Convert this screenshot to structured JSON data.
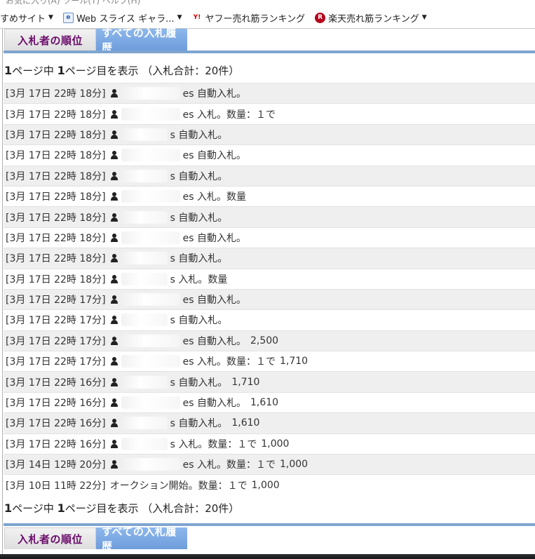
{
  "browser": {
    "menu_strip": "お気に入り(A)   ツール(T)   ヘルプ(H)",
    "favorites": [
      {
        "label": "すめサイト",
        "icon": "none",
        "dropdown": true
      },
      {
        "label": "Web スライス ギャラ...",
        "icon": "web-slice-icon",
        "dropdown": true
      },
      {
        "label": "ヤフー売れ筋ランキング",
        "icon": "yahoo-icon",
        "dropdown": false
      },
      {
        "label": "楽天売れ筋ランキング",
        "icon": "rakuten-icon",
        "dropdown": true
      }
    ]
  },
  "tabs": {
    "rank_label": "入札者の順位",
    "history_label": "すべての入札履歴"
  },
  "pagination": {
    "page_total": "1",
    "text_mid": "ページ中 ",
    "page_current": "1",
    "text_end": "ページ目を表示 （入札合計：20件）"
  },
  "bids": [
    {
      "time": "[3月 17日 22時 18分]",
      "user": true,
      "mask": "m1",
      "msg": "es 自動入札。",
      "amount": ""
    },
    {
      "time": "[3月 17日 22時 18分]",
      "user": true,
      "mask": "m1",
      "msg": "es 入札。数量：１で",
      "amount": ""
    },
    {
      "time": "[3月 17日 22時 18分]",
      "user": true,
      "mask": "m2",
      "msg": "s 自動入札。",
      "amount": ""
    },
    {
      "time": "[3月 17日 22時 18分]",
      "user": true,
      "mask": "m1",
      "msg": "es 自動入札。",
      "amount": ""
    },
    {
      "time": "[3月 17日 22時 18分]",
      "user": true,
      "mask": "m2",
      "msg": "s 自動入札。",
      "amount": ""
    },
    {
      "time": "[3月 17日 22時 18分]",
      "user": true,
      "mask": "m1",
      "msg": "es 入札。数量",
      "amount": ""
    },
    {
      "time": "[3月 17日 22時 18分]",
      "user": true,
      "mask": "m2",
      "msg": "s 自動入札。",
      "amount": ""
    },
    {
      "time": "[3月 17日 22時 18分]",
      "user": true,
      "mask": "m1",
      "msg": "es 自動入札。",
      "amount": ""
    },
    {
      "time": "[3月 17日 22時 18分]",
      "user": true,
      "mask": "m2",
      "msg": "s 自動入札。",
      "amount": ""
    },
    {
      "time": "[3月 17日 22時 18分]",
      "user": true,
      "mask": "m2",
      "msg": "s 入札。数量",
      "amount": ""
    },
    {
      "time": "[3月 17日 22時 17分]",
      "user": true,
      "mask": "m1",
      "msg": "es 自動入札。",
      "amount": ""
    },
    {
      "time": "[3月 17日 22時 17分]",
      "user": true,
      "mask": "m2",
      "msg": "s 自動入札。",
      "amount": ""
    },
    {
      "time": "[3月 17日 22時 17分]",
      "user": true,
      "mask": "m1",
      "msg": "es 自動入札。",
      "amount": "2,500"
    },
    {
      "time": "[3月 17日 22時 17分]",
      "user": true,
      "mask": "m1",
      "msg": "es 入札。数量：１で",
      "amount": "1,710"
    },
    {
      "time": "[3月 17日 22時 16分]",
      "user": true,
      "mask": "m2",
      "msg": "s 自動入札。",
      "amount": "1,710"
    },
    {
      "time": "[3月 17日 22時 16分]",
      "user": true,
      "mask": "m1",
      "msg": "es 自動入札。",
      "amount": "1,610"
    },
    {
      "time": "[3月 17日 22時 16分]",
      "user": true,
      "mask": "m2",
      "msg": "s 自動入札。",
      "amount": "1,610"
    },
    {
      "time": "[3月 17日 22時 16分]",
      "user": true,
      "mask": "m2",
      "msg": "s 入札。数量：１で",
      "amount": "1,000"
    },
    {
      "time": "[3月 14日 12時 20分]",
      "user": true,
      "mask": "m1",
      "msg": "es 入札。数量：１で",
      "amount": "1,000"
    },
    {
      "time": "[3月 10日 11時 22分]",
      "user": false,
      "mask": "",
      "msg": "オークション開始。数量：１で",
      "amount": "1,000"
    }
  ]
}
